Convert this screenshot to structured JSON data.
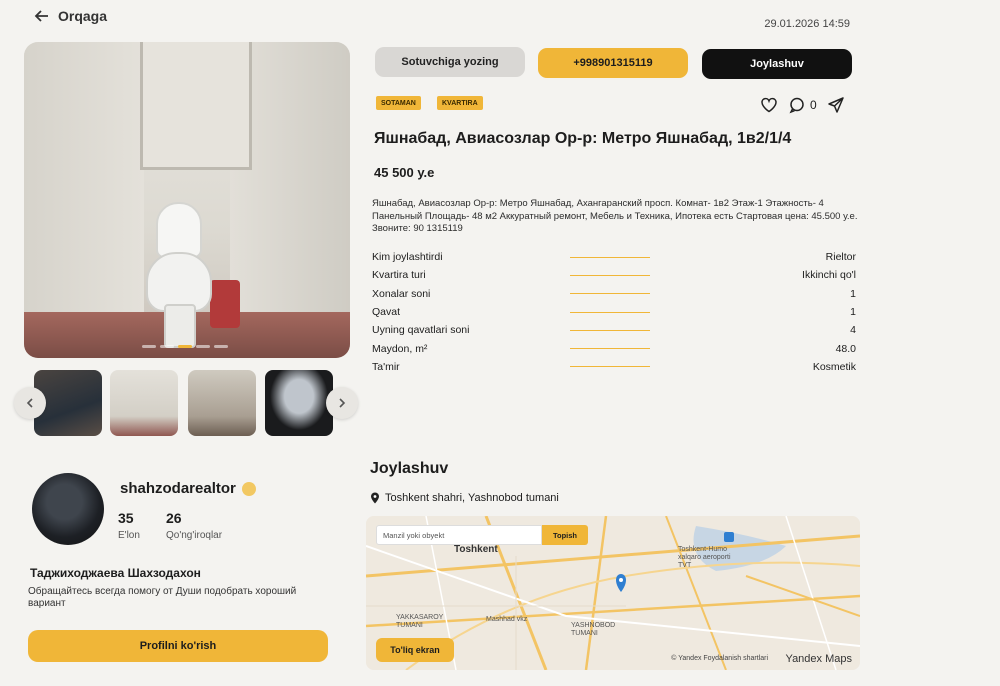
{
  "header": {
    "back_label": "Orqaga",
    "datetime": "29.01.2026 14:59"
  },
  "actions": {
    "seller_label": "Sotuvchiga yozing",
    "phone_label": "+998901315119",
    "location_label": "Joylashuv"
  },
  "tags": [
    "SOTAMAN",
    "KVARTIRA"
  ],
  "comments_count": "0",
  "listing": {
    "title": "Яшнабад, Авиасозлар Ор-р: Метро Яшнабад, 1в2/1/4",
    "price": "45 500 у.е",
    "description": "Яшнабад, Авиасозлар Ор-р: Метро Яшнабад, Ахангаранский просп. Комнат- 1в2 Этаж-1 Этажность- 4 Панельный Площадь- 48 м2 Аккуратный ремонт, Мебель и Техника, Ипотека есть Стартовая цена: 45.500 у.е. Звоните: 90 1315119"
  },
  "specs": [
    {
      "label": "Kim joylashtirdi",
      "value": "Rieltor"
    },
    {
      "label": "Kvartira turi",
      "value": "Ikkinchi qo'l"
    },
    {
      "label": "Xonalar soni",
      "value": "1"
    },
    {
      "label": "Qavat",
      "value": "1"
    },
    {
      "label": "Uyning qavatlari soni",
      "value": "4"
    },
    {
      "label": "Maydon, m²",
      "value": "48.0"
    },
    {
      "label": "Ta'mir",
      "value": "Kosmetik"
    }
  ],
  "location": {
    "title": "Joylashuv",
    "address": "Toshkent shahri, Yashnobod tumani"
  },
  "map": {
    "search_placeholder": "Manzil yoki obyekt",
    "search_button": "Topish",
    "city_label": "Toshkent",
    "airport_label": "Toshkent-Humo xalqaro aeroporti TVT",
    "district1": "YAKKASAROY TUMANI",
    "district2": "YASHNOBOD TUMANI",
    "place_label": "Mashhad vkz",
    "fullscreen_label": "To'liq ekran",
    "copyright": "© Yandex Foydalanish shartlari",
    "brand": "Yandex Maps"
  },
  "profile": {
    "username": "shahzodarealtor",
    "listings_count": "35",
    "listings_label": "E'lon",
    "calls_count": "26",
    "calls_label": "Qo'ng'iroqlar",
    "full_name": "Таджиходжаева Шахзодахон",
    "bio": "Обращайтесь всегда помогу от Души подобрать хороший вариант",
    "view_profile_label": "Profilni ko'rish"
  },
  "colors": {
    "accent": "#f0b638",
    "dark_button": "#111111",
    "background": "#f4f3f0"
  }
}
